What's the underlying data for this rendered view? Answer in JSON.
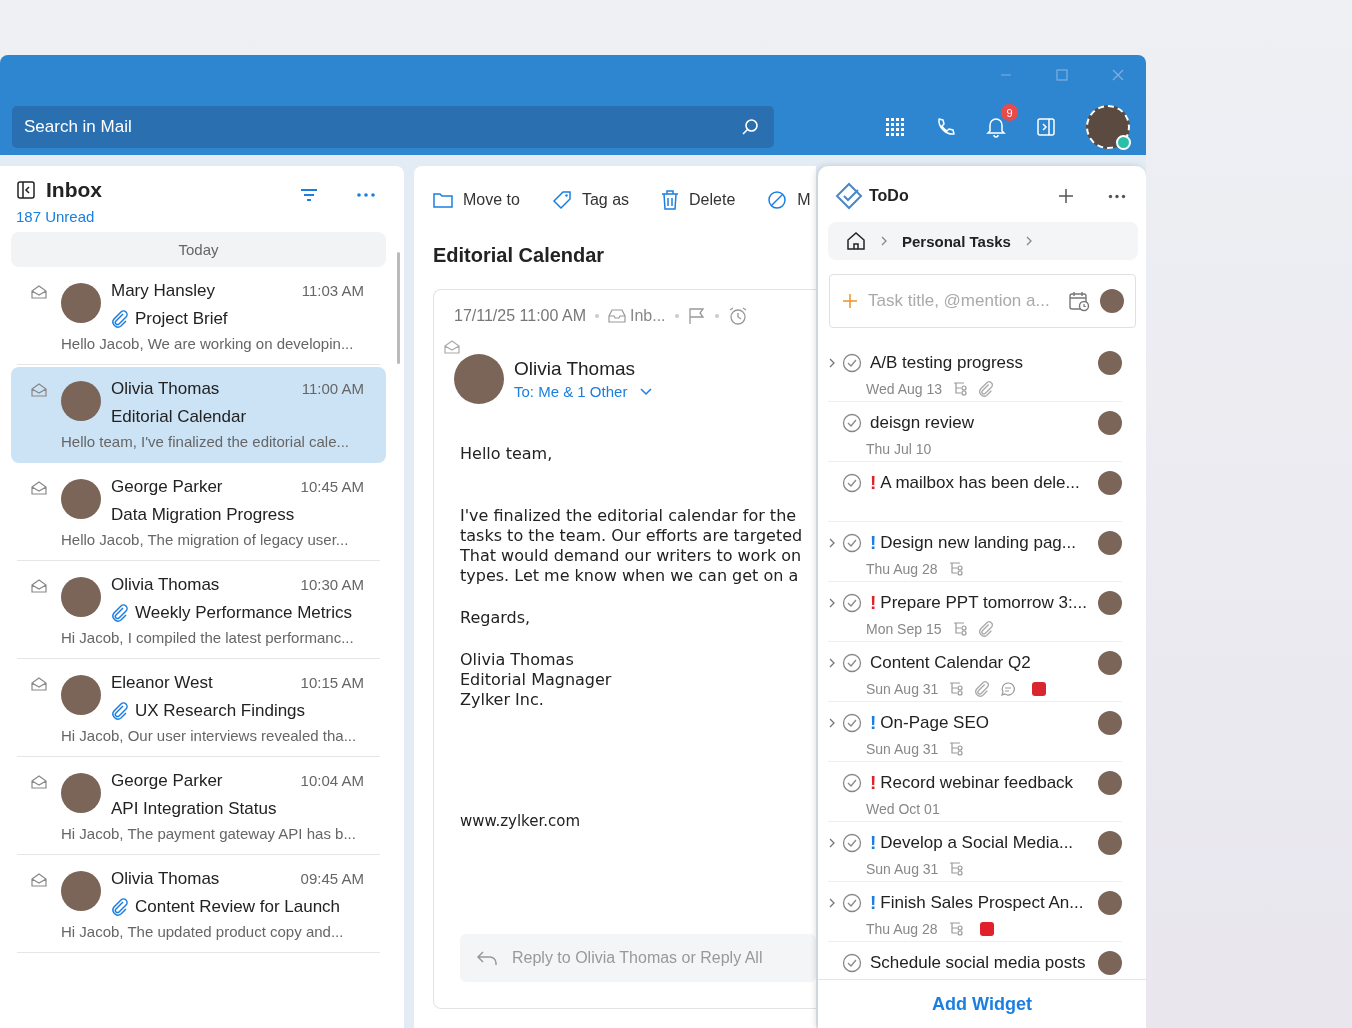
{
  "header": {
    "search": {
      "placeholder": "Search in Mail"
    },
    "notifications": {
      "count": "9"
    }
  },
  "mail_list": {
    "title": "Inbox",
    "unread": "187 Unread",
    "group": "Today",
    "items": [
      {
        "sender": "Mary Hansley",
        "time": "11:03 AM",
        "subject": "Project Brief",
        "attachment": true,
        "preview": "Hello Jacob, We are working on developin...",
        "selected": false
      },
      {
        "sender": "Olivia Thomas",
        "time": "11:00 AM",
        "subject": "Editorial Calendar",
        "attachment": false,
        "preview": "Hello team, I've finalized the editorial cale...",
        "selected": true
      },
      {
        "sender": "George Parker",
        "time": "10:45 AM",
        "subject": "Data Migration Progress",
        "attachment": false,
        "preview": "Hello Jacob, The migration of legacy user...",
        "selected": false
      },
      {
        "sender": "Olivia Thomas",
        "time": "10:30 AM",
        "subject": "Weekly Performance Metrics",
        "attachment": true,
        "preview": "Hi Jacob, I compiled the latest performanc...",
        "selected": false
      },
      {
        "sender": "Eleanor West",
        "time": "10:15 AM",
        "subject": "UX Research Findings",
        "attachment": true,
        "preview": "Hi Jacob, Our user interviews revealed tha...",
        "selected": false
      },
      {
        "sender": "George Parker",
        "time": "10:04 AM",
        "subject": "API Integration Status",
        "attachment": false,
        "preview": "Hi Jacob, The payment gateway API has b...",
        "selected": false
      },
      {
        "sender": "Olivia Thomas",
        "time": "09:45 AM",
        "subject": "Content Review for Launch",
        "attachment": true,
        "preview": "Hi Jacob, The updated product copy and...",
        "selected": false
      }
    ]
  },
  "reader": {
    "toolbar": [
      {
        "kind": "folder",
        "label": "Move to"
      },
      {
        "kind": "tag",
        "label": "Tag as"
      },
      {
        "kind": "trash",
        "label": "Delete"
      },
      {
        "kind": "block",
        "label": "M"
      }
    ],
    "subject": "Editorial Calendar",
    "date": "17/11/25 11:00 AM",
    "folder": "Inb...",
    "sender": "Olivia Thomas",
    "recipients": "To: Me & 1 Other",
    "body": [
      {
        "lines": [
          "Hello team,"
        ]
      },
      {
        "lines": [
          "I've finalized the editorial calendar for the",
          "tasks to the team. Our efforts are targeted",
          "That would demand our writers to work on",
          "types. Let me know when we can get on a"
        ]
      },
      {
        "lines": [
          "Regards,"
        ]
      },
      {
        "lines": [
          "Olivia Thomas",
          "Editorial Magnager",
          "Zylker Inc."
        ]
      }
    ],
    "link": "www.zylker.com",
    "reply": "Reply to Olivia Thomas or Reply All"
  },
  "todo": {
    "title": "ToDo",
    "breadcrumb": "Personal Tasks",
    "task_input": {
      "placeholder": "Task title, @mention a..."
    },
    "tasks": [
      {
        "title": "A/B testing progress",
        "expandable": true,
        "date": "Wed Aug 13",
        "subtasks": true,
        "attachment": true,
        "comment": false
      },
      {
        "title": "deisgn review",
        "expandable": false,
        "date": "Thu Jul 10",
        "subtasks": false,
        "attachment": false,
        "comment": false
      },
      {
        "title": "A mailbox has been dele...",
        "expandable": false,
        "priority": {
          "mark": "!",
          "color": "#e0202a"
        },
        "subtasks": false,
        "attachment": false,
        "comment": false
      },
      {
        "title": "Design new landing pag...",
        "expandable": true,
        "priority": {
          "mark": "!",
          "color": "#1a7fe0"
        },
        "date": "Thu Aug 28",
        "subtasks": true,
        "attachment": false,
        "comment": false
      },
      {
        "title": "Prepare PPT tomorrow 3:...",
        "expandable": true,
        "priority": {
          "mark": "!",
          "color": "#e0202a"
        },
        "date": "Mon Sep 15",
        "subtasks": true,
        "attachment": true,
        "comment": false
      },
      {
        "title": "Content Calendar Q2",
        "expandable": true,
        "date": "Sun Aug 31",
        "subtasks": true,
        "attachment": true,
        "comment": true,
        "color": "#d9252f"
      },
      {
        "title": "On-Page SEO",
        "expandable": true,
        "priority": {
          "mark": "!",
          "color": "#1a7fe0"
        },
        "date": "Sun Aug 31",
        "subtasks": true,
        "attachment": false,
        "comment": false
      },
      {
        "title": "Record webinar feedback",
        "expandable": false,
        "priority": {
          "mark": "!",
          "color": "#e0202a"
        },
        "date": "Wed Oct 01",
        "subtasks": false,
        "attachment": false,
        "comment": false
      },
      {
        "title": "Develop a Social Media...",
        "expandable": true,
        "priority": {
          "mark": "!",
          "color": "#1a7fe0"
        },
        "date": "Sun Aug 31",
        "subtasks": true,
        "attachment": false,
        "comment": false
      },
      {
        "title": "Finish Sales Prospect An...",
        "expandable": true,
        "priority": {
          "mark": "!",
          "color": "#1a7fe0"
        },
        "date": "Thu Aug 28",
        "subtasks": true,
        "attachment": false,
        "comment": false,
        "color": "#e0202a"
      },
      {
        "title": "Schedule social media posts",
        "expandable": false,
        "subtasks": false,
        "attachment": false,
        "comment": false
      }
    ],
    "footer": "Add Widget"
  }
}
